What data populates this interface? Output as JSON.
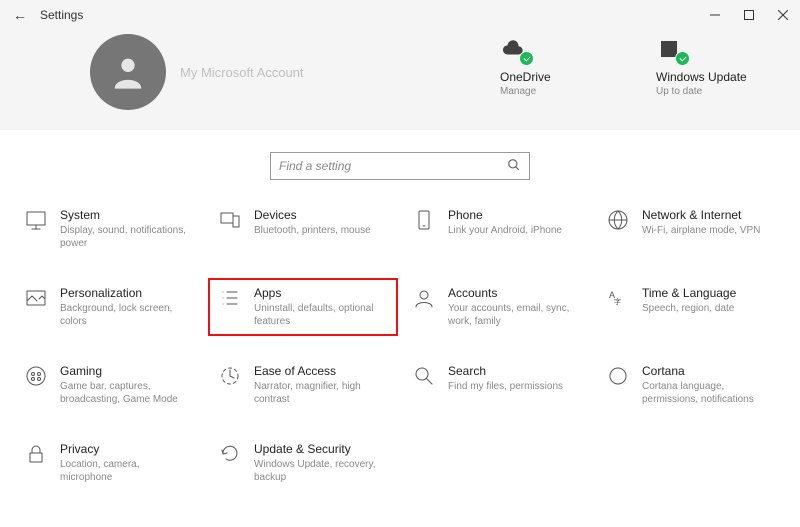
{
  "window": {
    "title": "Settings"
  },
  "account": {
    "name": "My Microsoft Account"
  },
  "status": [
    {
      "title": "OneDrive",
      "sub": "Manage",
      "icon": "cloud"
    },
    {
      "title": "Windows Update",
      "sub": "Up to date",
      "icon": "sync"
    }
  ],
  "search": {
    "placeholder": "Find a setting"
  },
  "categories": [
    {
      "title": "System",
      "desc": "Display, sound, notifications, power",
      "icon": "system"
    },
    {
      "title": "Devices",
      "desc": "Bluetooth, printers, mouse",
      "icon": "devices"
    },
    {
      "title": "Phone",
      "desc": "Link your Android, iPhone",
      "icon": "phone"
    },
    {
      "title": "Network & Internet",
      "desc": "Wi-Fi, airplane mode, VPN",
      "icon": "network"
    },
    {
      "title": "Personalization",
      "desc": "Background, lock screen, colors",
      "icon": "personalization"
    },
    {
      "title": "Apps",
      "desc": "Uninstall, defaults, optional features",
      "icon": "apps",
      "highlight": true
    },
    {
      "title": "Accounts",
      "desc": "Your accounts, email, sync, work, family",
      "icon": "accounts"
    },
    {
      "title": "Time & Language",
      "desc": "Speech, region, date",
      "icon": "time"
    },
    {
      "title": "Gaming",
      "desc": "Game bar, captures, broadcasting, Game Mode",
      "icon": "gaming"
    },
    {
      "title": "Ease of Access",
      "desc": "Narrator, magnifier, high contrast",
      "icon": "ease"
    },
    {
      "title": "Search",
      "desc": "Find my files, permissions",
      "icon": "search"
    },
    {
      "title": "Cortana",
      "desc": "Cortana language, permissions, notifications",
      "icon": "cortana"
    },
    {
      "title": "Privacy",
      "desc": "Location, camera, microphone",
      "icon": "privacy"
    },
    {
      "title": "Update & Security",
      "desc": "Windows Update, recovery, backup",
      "icon": "update"
    }
  ]
}
